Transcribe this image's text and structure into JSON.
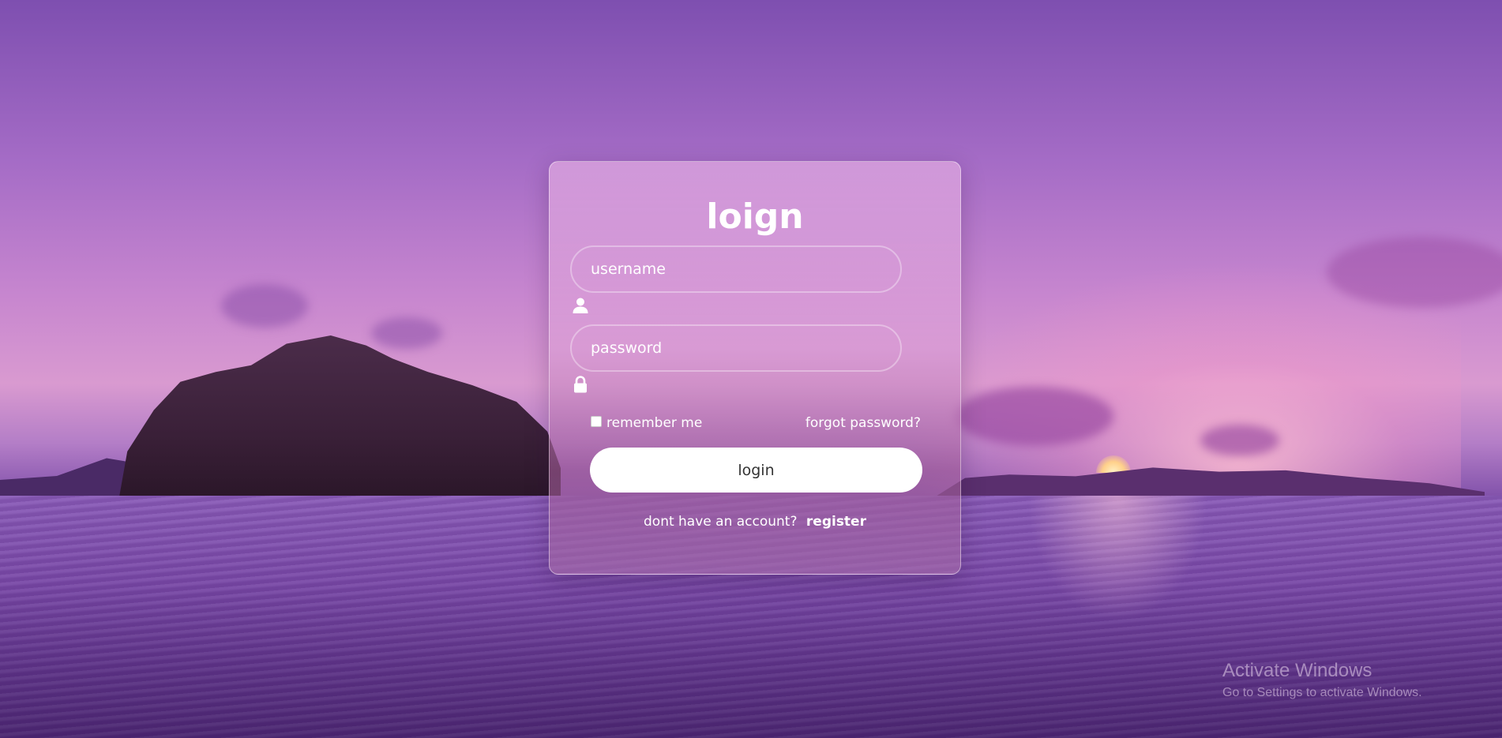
{
  "form": {
    "title": "loign",
    "username_placeholder": "username",
    "password_placeholder": "password",
    "remember_label": "remember me",
    "remember_checked": false,
    "forgot_label": "forgot password?",
    "login_button_label": "login",
    "register_prompt": "dont have an account?",
    "register_link_label": "register"
  },
  "icons": {
    "username": "user-icon",
    "password": "lock-icon"
  },
  "watermark": {
    "title": "Activate Windows",
    "subtitle": "Go to Settings to activate Windows."
  },
  "colors": {
    "card_border": "#ffffff",
    "button_bg": "#ffffff",
    "button_text": "#333333",
    "text": "#ffffff"
  }
}
